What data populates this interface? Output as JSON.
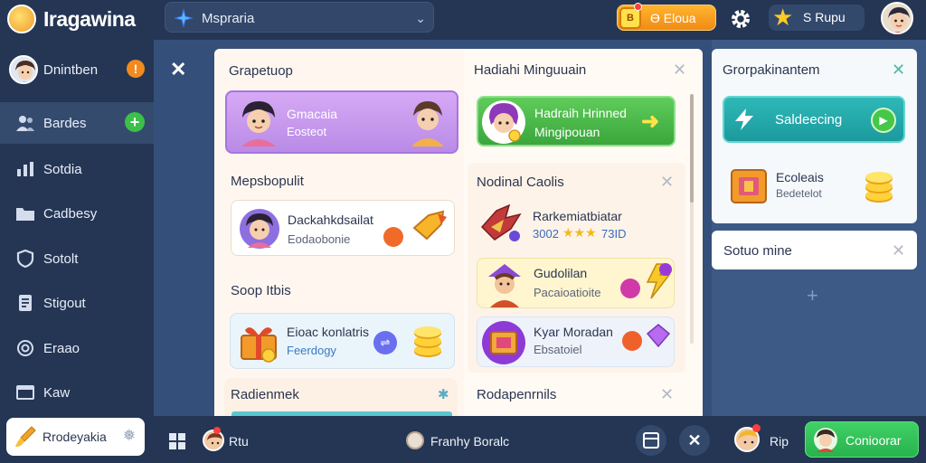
{
  "app": {
    "title": "Iragawina"
  },
  "search": {
    "value": "Mspraria"
  },
  "header": {
    "coin_label": "Ɵ Eloua",
    "coin_icon_text": "B",
    "star_label": "S Rupu"
  },
  "sidebar": {
    "items": [
      {
        "label": "Dnintben"
      },
      {
        "label": "Bardes"
      },
      {
        "label": "Sotdia"
      },
      {
        "label": "Cadbesy"
      },
      {
        "label": "Sotolt"
      },
      {
        "label": "Stigout"
      },
      {
        "label": "Eraao"
      },
      {
        "label": "Kaw"
      }
    ],
    "bottom_label": "Rrodeyakia"
  },
  "main": {
    "left_col": {
      "title_1": "Grapetuop",
      "card_1": {
        "line1": "Gmacaia",
        "line2": "Eosteot"
      },
      "title_2": "Mepsbopulit",
      "card_2": {
        "line1": "Dackahkdsailat",
        "line2": "Eodaobonie"
      },
      "title_3": "Soop Itbis",
      "card_3": {
        "line1": "Eioac konlatris",
        "line2": "Feerdogy"
      },
      "title_4": "Radienmek"
    },
    "right_col": {
      "title_1": "Hadiahi Minguuain",
      "green_card": {
        "line1": "Hadraih Hrinned",
        "line2": "Mingipouan"
      },
      "title_2": "Nodinal Caolis",
      "card_a": {
        "line1": "Rarkemiatbiatar",
        "line2": "3002",
        "line2b": "73ID"
      },
      "card_b": {
        "line1": "Gudolilan",
        "line2": "Pacaioatioite"
      },
      "card_c": {
        "line1": "Kyar Moradan",
        "line2": "Ebsatoiel"
      },
      "title_3": "Rodapenrnils"
    }
  },
  "right_panel": {
    "title": "Grorpakinantem",
    "teal_button": "Saldeecing",
    "item": {
      "line1": "Ecoleais",
      "line2": "Bedetelot"
    },
    "section_title": "Sotuo mine"
  },
  "bottom": {
    "user1": "Rtu",
    "center_label": "Franhy Boralc",
    "user2": "Rip",
    "continue": "Conioorar"
  },
  "colors": {
    "sidebar_bg": "#243654",
    "main_bg": "#34507a",
    "accent_yellow": "#f6c127",
    "purple": "#c79bf0",
    "green": "#3fbf4d",
    "teal": "#1fa8ae",
    "orange": "#f28a1e"
  }
}
